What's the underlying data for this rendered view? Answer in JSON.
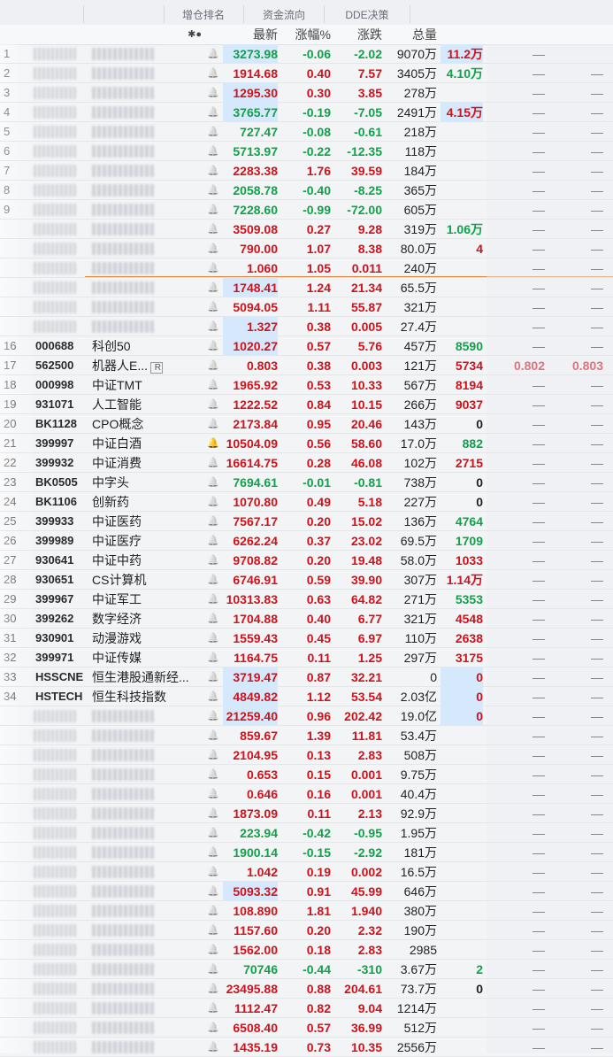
{
  "tabs": [
    "增仓排名",
    "资金流向",
    "DDE决策"
  ],
  "header": {
    "icons": "✱●",
    "latest": "最新",
    "pct": "涨幅%",
    "chg": "涨跌",
    "vol": "总量"
  },
  "colors": {
    "up": "#d0121b",
    "down": "#11a14a",
    "highlight": "#d6e8fb",
    "accent_line": "#e0701e"
  },
  "rows": [
    {
      "idx": "1",
      "code": "",
      "name": "",
      "latest": "3273.98",
      "pct": "-0.06",
      "chg": "-2.02",
      "vol": "9070万",
      "x": "11.2万",
      "y": "—",
      "z": "",
      "dir": "down",
      "hl": true,
      "xdir": "red",
      "xhl": true
    },
    {
      "idx": "2",
      "code": "",
      "name": "",
      "latest": "1914.68",
      "pct": "0.40",
      "chg": "7.57",
      "vol": "3405万",
      "x": "4.10万",
      "y": "—",
      "z": "—",
      "dir": "up",
      "hl": false,
      "xdir": "green",
      "xhl": false
    },
    {
      "idx": "3",
      "code": "",
      "name": "",
      "latest": "1295.30",
      "pct": "0.30",
      "chg": "3.85",
      "vol": "278万",
      "x": "",
      "y": "—",
      "z": "—",
      "dir": "up",
      "hl": true,
      "xdir": "red",
      "xhl": false
    },
    {
      "idx": "4",
      "code": "",
      "name": "",
      "latest": "3765.77",
      "pct": "-0.19",
      "chg": "-7.05",
      "vol": "2491万",
      "x": "4.15万",
      "y": "—",
      "z": "—",
      "dir": "down",
      "hl": true,
      "xdir": "red",
      "xhl": true
    },
    {
      "idx": "5",
      "code": "",
      "name": "",
      "latest": "727.47",
      "pct": "-0.08",
      "chg": "-0.61",
      "vol": "218万",
      "x": "",
      "y": "—",
      "z": "—",
      "dir": "down",
      "hl": false,
      "xdir": "red",
      "xhl": false
    },
    {
      "idx": "6",
      "code": "",
      "name": "",
      "latest": "5713.97",
      "pct": "-0.22",
      "chg": "-12.35",
      "vol": "118万",
      "x": "",
      "y": "—",
      "z": "—",
      "dir": "down",
      "hl": false,
      "xdir": "red",
      "xhl": false
    },
    {
      "idx": "7",
      "code": "",
      "name": "",
      "latest": "2283.38",
      "pct": "1.76",
      "chg": "39.59",
      "vol": "184万",
      "x": "",
      "y": "—",
      "z": "—",
      "dir": "up",
      "hl": false,
      "xdir": "red",
      "xhl": false
    },
    {
      "idx": "8",
      "code": "",
      "name": "",
      "latest": "2058.78",
      "pct": "-0.40",
      "chg": "-8.25",
      "vol": "365万",
      "x": "",
      "y": "—",
      "z": "—",
      "dir": "down",
      "hl": false,
      "xdir": "red",
      "xhl": false
    },
    {
      "idx": "9",
      "code": "",
      "name": "",
      "latest": "7228.60",
      "pct": "-0.99",
      "chg": "-72.00",
      "vol": "605万",
      "x": "",
      "y": "—",
      "z": "—",
      "dir": "down",
      "hl": false,
      "xdir": "red",
      "xhl": false
    },
    {
      "idx": "",
      "code": "",
      "name": "",
      "latest": "3509.08",
      "pct": "0.27",
      "chg": "9.28",
      "vol": "319万",
      "x": "1.06万",
      "y": "—",
      "z": "—",
      "dir": "up",
      "hl": false,
      "xdir": "green",
      "xhl": false
    },
    {
      "idx": "",
      "code": "",
      "name": "",
      "latest": "790.00",
      "pct": "1.07",
      "chg": "8.38",
      "vol": "80.0万",
      "x": "4",
      "y": "—",
      "z": "—",
      "dir": "up",
      "hl": false,
      "xdir": "red",
      "xhl": false
    },
    {
      "idx": "",
      "code": "",
      "name": "",
      "latest": "1.060",
      "pct": "1.05",
      "chg": "0.011",
      "vol": "240万",
      "x": "",
      "y": "—",
      "z": "—",
      "dir": "up",
      "hl": false,
      "xdir": "red",
      "xhl": false
    },
    {
      "idx": "",
      "code": "",
      "name": "",
      "latest": "1748.41",
      "pct": "1.24",
      "chg": "21.34",
      "vol": "65.5万",
      "x": "",
      "y": "—",
      "z": "—",
      "dir": "up",
      "hl": true,
      "xdir": "red",
      "xhl": false
    },
    {
      "idx": "",
      "code": "",
      "name": "",
      "latest": "5094.05",
      "pct": "1.11",
      "chg": "55.87",
      "vol": "321万",
      "x": "",
      "y": "—",
      "z": "—",
      "dir": "up",
      "hl": false,
      "xdir": "red",
      "xhl": false
    },
    {
      "idx": "",
      "code": "",
      "name": "",
      "latest": "1.327",
      "pct": "0.38",
      "chg": "0.005",
      "vol": "27.4万",
      "x": "",
      "y": "—",
      "z": "—",
      "dir": "up",
      "hl": true,
      "xdir": "red",
      "xhl": false
    },
    {
      "idx": "16",
      "code": "000688",
      "name": "科创50",
      "latest": "1020.27",
      "pct": "0.57",
      "chg": "5.76",
      "vol": "457万",
      "x": "8590",
      "y": "—",
      "z": "—",
      "dir": "up",
      "hl": true,
      "xdir": "green",
      "xhl": false
    },
    {
      "idx": "17",
      "code": "562500",
      "name": "机器人E...",
      "badge": "R",
      "latest": "0.803",
      "pct": "0.38",
      "chg": "0.003",
      "vol": "121万",
      "x": "5734",
      "y": "0.802",
      "z": "0.803",
      "dir": "up",
      "hl": false,
      "xdir": "red",
      "xhl": false,
      "yzred": true
    },
    {
      "idx": "18",
      "code": "000998",
      "name": "中证TMT",
      "latest": "1965.92",
      "pct": "0.53",
      "chg": "10.33",
      "vol": "567万",
      "x": "8194",
      "y": "—",
      "z": "—",
      "dir": "up",
      "hl": false,
      "xdir": "red",
      "xhl": false
    },
    {
      "idx": "19",
      "code": "931071",
      "name": "人工智能",
      "latest": "1222.52",
      "pct": "0.84",
      "chg": "10.15",
      "vol": "266万",
      "x": "9037",
      "y": "—",
      "z": "—",
      "dir": "up",
      "hl": false,
      "xdir": "red",
      "xhl": false
    },
    {
      "idx": "20",
      "code": "BK1128",
      "name": "CPO概念",
      "latest": "2173.84",
      "pct": "0.95",
      "chg": "20.46",
      "vol": "143万",
      "x": "0",
      "y": "—",
      "z": "—",
      "dir": "up",
      "hl": false,
      "xdir": "dark",
      "xhl": false
    },
    {
      "idx": "21",
      "code": "399997",
      "name": "中证白酒",
      "bell": "alert",
      "latest": "10504.09",
      "pct": "0.56",
      "chg": "58.60",
      "vol": "17.0万",
      "x": "882",
      "y": "—",
      "z": "—",
      "dir": "up",
      "hl": false,
      "xdir": "green",
      "xhl": false
    },
    {
      "idx": "22",
      "code": "399932",
      "name": "中证消费",
      "latest": "16614.75",
      "pct": "0.28",
      "chg": "46.08",
      "vol": "102万",
      "x": "2715",
      "y": "—",
      "z": "—",
      "dir": "up",
      "hl": false,
      "xdir": "red",
      "xhl": false
    },
    {
      "idx": "23",
      "code": "BK0505",
      "name": "中字头",
      "latest": "7694.61",
      "pct": "-0.01",
      "chg": "-0.81",
      "vol": "738万",
      "x": "0",
      "y": "—",
      "z": "—",
      "dir": "down",
      "hl": false,
      "xdir": "dark",
      "xhl": false
    },
    {
      "idx": "24",
      "code": "BK1106",
      "name": "创新药",
      "latest": "1070.80",
      "pct": "0.49",
      "chg": "5.18",
      "vol": "227万",
      "x": "0",
      "y": "—",
      "z": "—",
      "dir": "up",
      "hl": false,
      "xdir": "dark",
      "xhl": false
    },
    {
      "idx": "25",
      "code": "399933",
      "name": "中证医药",
      "latest": "7567.17",
      "pct": "0.20",
      "chg": "15.02",
      "vol": "136万",
      "x": "4764",
      "y": "—",
      "z": "—",
      "dir": "up",
      "hl": false,
      "xdir": "green",
      "xhl": false
    },
    {
      "idx": "26",
      "code": "399989",
      "name": "中证医疗",
      "latest": "6262.24",
      "pct": "0.37",
      "chg": "23.02",
      "vol": "69.5万",
      "x": "1709",
      "y": "—",
      "z": "—",
      "dir": "up",
      "hl": false,
      "xdir": "green",
      "xhl": false
    },
    {
      "idx": "27",
      "code": "930641",
      "name": "中证中药",
      "latest": "9708.82",
      "pct": "0.20",
      "chg": "19.48",
      "vol": "58.0万",
      "x": "1033",
      "y": "—",
      "z": "—",
      "dir": "up",
      "hl": false,
      "xdir": "red",
      "xhl": false
    },
    {
      "idx": "28",
      "code": "930651",
      "name": "CS计算机",
      "latest": "6746.91",
      "pct": "0.59",
      "chg": "39.90",
      "vol": "307万",
      "x": "1.14万",
      "y": "—",
      "z": "—",
      "dir": "up",
      "hl": false,
      "xdir": "red",
      "xhl": false
    },
    {
      "idx": "29",
      "code": "399967",
      "name": "中证军工",
      "latest": "10313.83",
      "pct": "0.63",
      "chg": "64.82",
      "vol": "271万",
      "x": "5353",
      "y": "—",
      "z": "—",
      "dir": "up",
      "hl": false,
      "xdir": "green",
      "xhl": false
    },
    {
      "idx": "30",
      "code": "399262",
      "name": "数字经济",
      "latest": "1704.88",
      "pct": "0.40",
      "chg": "6.77",
      "vol": "321万",
      "x": "4548",
      "y": "—",
      "z": "—",
      "dir": "up",
      "hl": false,
      "xdir": "red",
      "xhl": false
    },
    {
      "idx": "31",
      "code": "930901",
      "name": "动漫游戏",
      "latest": "1559.43",
      "pct": "0.45",
      "chg": "6.97",
      "vol": "110万",
      "x": "2638",
      "y": "—",
      "z": "—",
      "dir": "up",
      "hl": false,
      "xdir": "red",
      "xhl": false
    },
    {
      "idx": "32",
      "code": "399971",
      "name": "中证传媒",
      "latest": "1164.75",
      "pct": "0.11",
      "chg": "1.25",
      "vol": "297万",
      "x": "3175",
      "y": "—",
      "z": "—",
      "dir": "up",
      "hl": false,
      "xdir": "red",
      "xhl": false
    },
    {
      "idx": "33",
      "code": "HSSCNE",
      "name": "恒生港股通新经...",
      "latest": "3719.47",
      "pct": "0.87",
      "chg": "32.21",
      "vol": "0",
      "x": "0",
      "y": "—",
      "z": "—",
      "dir": "up",
      "hl": true,
      "xdir": "red",
      "xhl": true
    },
    {
      "idx": "34",
      "code": "HSTECH",
      "name": "恒生科技指数",
      "latest": "4849.82",
      "pct": "1.12",
      "chg": "53.54",
      "vol": "2.03亿",
      "x": "0",
      "y": "—",
      "z": "—",
      "dir": "up",
      "hl": true,
      "xdir": "red",
      "xhl": true
    },
    {
      "idx": "",
      "code": "",
      "name": "",
      "latest": "21259.40",
      "pct": "0.96",
      "chg": "202.42",
      "vol": "19.0亿",
      "x": "0",
      "y": "—",
      "z": "—",
      "dir": "up",
      "hl": true,
      "xdir": "red",
      "xhl": true
    },
    {
      "idx": "",
      "code": "",
      "name": "",
      "latest": "859.67",
      "pct": "1.39",
      "chg": "11.81",
      "vol": "53.4万",
      "x": "",
      "y": "—",
      "z": "—",
      "dir": "up",
      "hl": false,
      "xdir": "red",
      "xhl": false
    },
    {
      "idx": "",
      "code": "",
      "name": "",
      "latest": "2104.95",
      "pct": "0.13",
      "chg": "2.83",
      "vol": "508万",
      "x": "",
      "y": "—",
      "z": "—",
      "dir": "up",
      "hl": false,
      "xdir": "red",
      "xhl": false
    },
    {
      "idx": "",
      "code": "",
      "name": "",
      "latest": "0.653",
      "pct": "0.15",
      "chg": "0.001",
      "vol": "9.75万",
      "x": "",
      "y": "—",
      "z": "—",
      "dir": "up",
      "hl": false,
      "xdir": "red",
      "xhl": false
    },
    {
      "idx": "",
      "code": "",
      "name": "",
      "latest": "0.646",
      "pct": "0.16",
      "chg": "0.001",
      "vol": "40.4万",
      "x": "",
      "y": "—",
      "z": "—",
      "dir": "up",
      "hl": false,
      "xdir": "red",
      "xhl": false
    },
    {
      "idx": "",
      "code": "",
      "name": "",
      "latest": "1873.09",
      "pct": "0.11",
      "chg": "2.13",
      "vol": "92.9万",
      "x": "",
      "y": "—",
      "z": "—",
      "dir": "up",
      "hl": false,
      "xdir": "red",
      "xhl": false
    },
    {
      "idx": "",
      "code": "",
      "name": "",
      "latest": "223.94",
      "pct": "-0.42",
      "chg": "-0.95",
      "vol": "1.95万",
      "x": "",
      "y": "—",
      "z": "—",
      "dir": "down",
      "hl": false,
      "xdir": "red",
      "xhl": false
    },
    {
      "idx": "",
      "code": "",
      "name": "",
      "latest": "1900.14",
      "pct": "-0.15",
      "chg": "-2.92",
      "vol": "181万",
      "x": "",
      "y": "—",
      "z": "—",
      "dir": "down",
      "hl": false,
      "xdir": "red",
      "xhl": false
    },
    {
      "idx": "",
      "code": "",
      "name": "",
      "latest": "1.042",
      "pct": "0.19",
      "chg": "0.002",
      "vol": "16.5万",
      "x": "",
      "y": "—",
      "z": "—",
      "dir": "up",
      "hl": false,
      "xdir": "red",
      "xhl": false
    },
    {
      "idx": "",
      "code": "",
      "name": "",
      "latest": "5093.32",
      "pct": "0.91",
      "chg": "45.99",
      "vol": "646万",
      "x": "",
      "y": "—",
      "z": "—",
      "dir": "up",
      "hl": true,
      "xdir": "red",
      "xhl": false
    },
    {
      "idx": "",
      "code": "",
      "name": "",
      "latest": "108.890",
      "pct": "1.81",
      "chg": "1.940",
      "vol": "380万",
      "x": "",
      "y": "—",
      "z": "—",
      "dir": "up",
      "hl": false,
      "xdir": "red",
      "xhl": false
    },
    {
      "idx": "",
      "code": "",
      "name": "",
      "latest": "1157.60",
      "pct": "0.20",
      "chg": "2.32",
      "vol": "190万",
      "x": "",
      "y": "—",
      "z": "—",
      "dir": "up",
      "hl": false,
      "xdir": "red",
      "xhl": false
    },
    {
      "idx": "",
      "code": "",
      "name": "",
      "latest": "1562.00",
      "pct": "0.18",
      "chg": "2.83",
      "vol": "2985",
      "x": "",
      "y": "—",
      "z": "—",
      "dir": "up",
      "hl": false,
      "xdir": "red",
      "xhl": false
    },
    {
      "idx": "",
      "code": "",
      "name": "",
      "latest": "70746",
      "pct": "-0.44",
      "chg": "-310",
      "vol": "3.67万",
      "x": "2",
      "y": "—",
      "z": "—",
      "dir": "down",
      "hl": false,
      "xdir": "green",
      "xhl": false
    },
    {
      "idx": "",
      "code": "",
      "name": "",
      "latest": "23495.88",
      "pct": "0.88",
      "chg": "204.61",
      "vol": "73.7万",
      "x": "0",
      "y": "—",
      "z": "—",
      "dir": "up",
      "hl": false,
      "xdir": "dark",
      "xhl": false
    },
    {
      "idx": "",
      "code": "",
      "name": "",
      "latest": "1112.47",
      "pct": "0.82",
      "chg": "9.04",
      "vol": "1214万",
      "x": "",
      "y": "—",
      "z": "—",
      "dir": "up",
      "hl": false,
      "xdir": "red",
      "xhl": false
    },
    {
      "idx": "",
      "code": "",
      "name": "",
      "latest": "6508.40",
      "pct": "0.57",
      "chg": "36.99",
      "vol": "512万",
      "x": "",
      "y": "—",
      "z": "—",
      "dir": "up",
      "hl": false,
      "xdir": "red",
      "xhl": false
    },
    {
      "idx": "",
      "code": "",
      "name": "",
      "latest": "1435.19",
      "pct": "0.73",
      "chg": "10.35",
      "vol": "2556万",
      "x": "",
      "y": "—",
      "z": "—",
      "dir": "up",
      "hl": false,
      "xdir": "red",
      "xhl": false
    }
  ]
}
